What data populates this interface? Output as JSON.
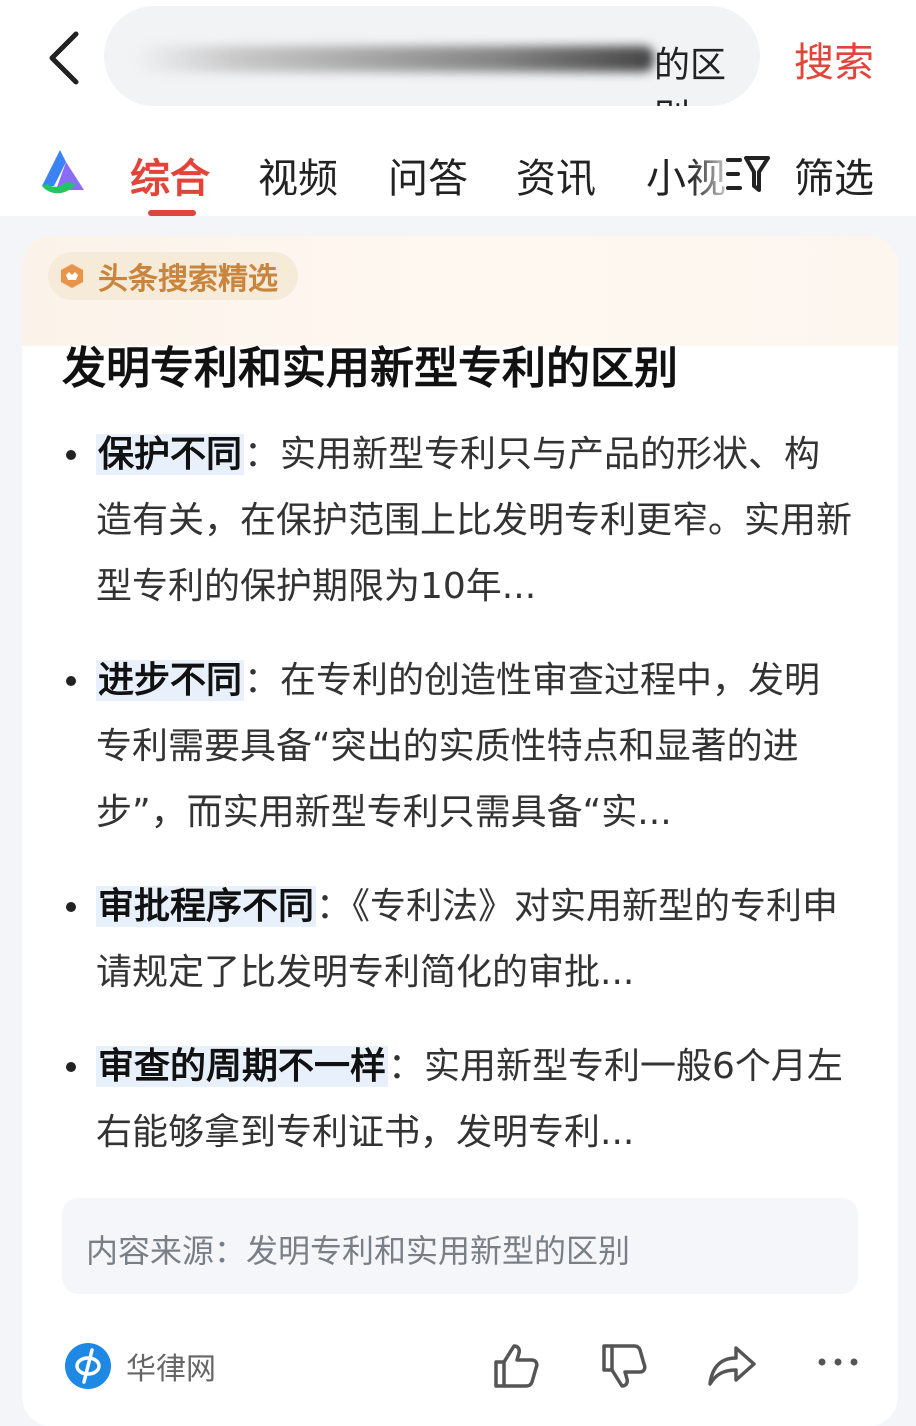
{
  "search": {
    "query_visible": "的区别",
    "submit_label": "搜索"
  },
  "tabs": [
    {
      "label": "综合",
      "active": true
    },
    {
      "label": "视频"
    },
    {
      "label": "问答"
    },
    {
      "label": "资讯"
    },
    {
      "label": "小视"
    }
  ],
  "filter_label": "筛选",
  "card": {
    "badge": "头条搜索精选",
    "title": "发明专利和实用新型专利的区别",
    "bullets": [
      {
        "head": "保护不同",
        "sep": "：",
        "text": "实用新型专利只与产品的形状、构造有关，在保护范围上比发明专利更窄。实用新型专利的保护期限为10年..."
      },
      {
        "head": "进步不同",
        "sep": "：",
        "text": "在专利的创造性审查过程中，发明专利需要具备“突出的实质性特点和显著的进步”，而实用新型专利只需具备“实..."
      },
      {
        "head": "审批程序不同",
        "sep": "：",
        "text": "《专利法》对实用新型的专利申请规定了比发明专利简化的审批..."
      },
      {
        "head": "审查的周期不一样",
        "sep": "：",
        "text": "实用新型专利一般6个月左右能够拿到专利证书，发明专利..."
      }
    ],
    "source_label": "内容来源：",
    "source_title": "发明专利和实用新型的区别",
    "site_name": "华律网"
  },
  "colors": {
    "accent": "#e2443a",
    "badge_text": "#c9843d",
    "highlight": "#e8f0fb"
  },
  "icons": [
    "back-arrow-icon",
    "clear-icon",
    "app-logo-icon",
    "filter-icon",
    "badge-icon",
    "site-logo-icon",
    "like-icon",
    "dislike-icon",
    "share-icon",
    "more-icon"
  ]
}
